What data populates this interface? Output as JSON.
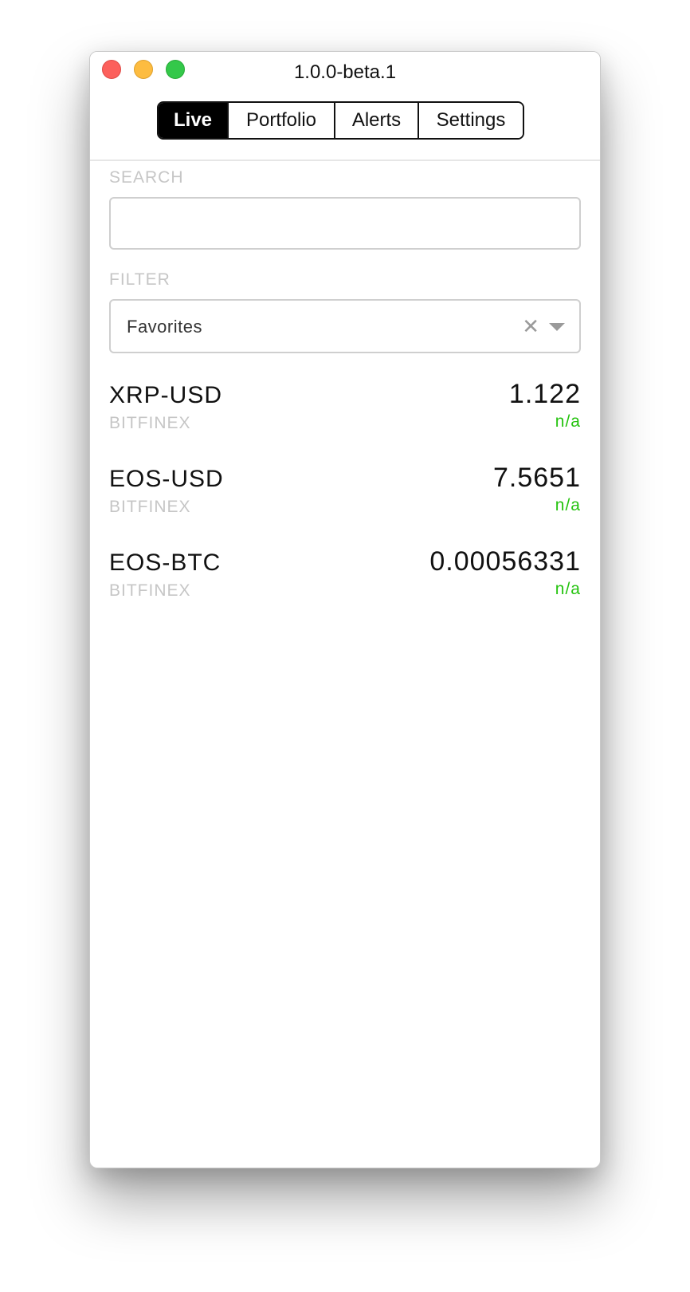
{
  "window": {
    "title": "1.0.0-beta.1"
  },
  "tabs": [
    {
      "label": "Live",
      "active": true
    },
    {
      "label": "Portfolio",
      "active": false
    },
    {
      "label": "Alerts",
      "active": false
    },
    {
      "label": "Settings",
      "active": false
    }
  ],
  "search": {
    "label": "SEARCH",
    "value": "",
    "placeholder": ""
  },
  "filter": {
    "label": "FILTER",
    "selected": "Favorites",
    "clear_icon": "close-icon",
    "dropdown_icon": "chevron-down-icon"
  },
  "tickers": [
    {
      "pair": "XRP-USD",
      "exchange": "BITFINEX",
      "price": "1.122",
      "change": "n/a"
    },
    {
      "pair": "EOS-USD",
      "exchange": "BITFINEX",
      "price": "7.5651",
      "change": "n/a"
    },
    {
      "pair": "EOS-BTC",
      "exchange": "BITFINEX",
      "price": "0.00056331",
      "change": "n/a"
    }
  ],
  "colors": {
    "change_positive": "#25c30f",
    "muted_text": "#c6c6c6",
    "active_tab_bg": "#000000"
  }
}
